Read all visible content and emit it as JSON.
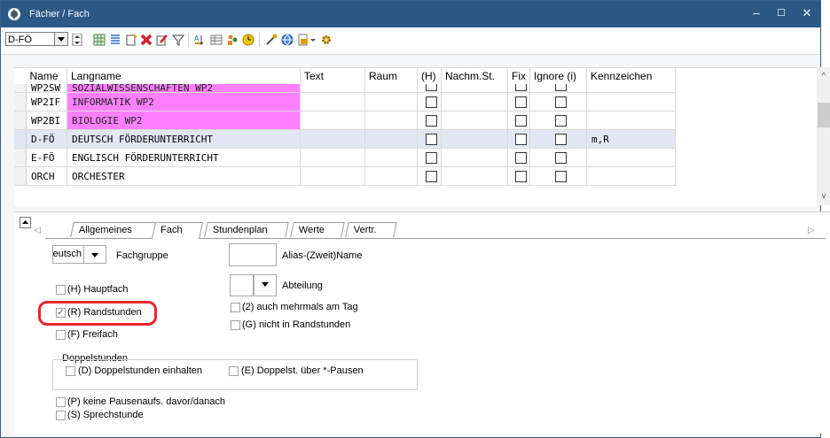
{
  "window": {
    "title": "Fächer / Fach",
    "minimize": "–",
    "maximize": "☐",
    "close": "✕"
  },
  "toolbar": {
    "combo_value": "D-FÖ"
  },
  "grid": {
    "columns": [
      "Name",
      "Langname",
      "Text",
      "Raum",
      "(H)",
      "Nachm.St.",
      "Fix",
      "Ignore (i)",
      "Kennzeichen"
    ],
    "rows": [
      {
        "name": "WP2SW",
        "langname": "SOZIALWISSENSCHAFTEN WP2",
        "text": "",
        "raum": "",
        "nachm": "",
        "kennzeichen": "",
        "pink": true,
        "selected": false
      },
      {
        "name": "WP2IF",
        "langname": "INFORMATIK WP2",
        "text": "",
        "raum": "",
        "nachm": "",
        "kennzeichen": "",
        "pink": true,
        "selected": false
      },
      {
        "name": "WP2BI",
        "langname": "BIOLOGIE WP2",
        "text": "",
        "raum": "",
        "nachm": "",
        "kennzeichen": "",
        "pink": true,
        "selected": false
      },
      {
        "name": "D-FÖ",
        "langname": "DEUTSCH FÖRDERUNTERRICHT",
        "text": "",
        "raum": "",
        "nachm": "",
        "kennzeichen": "m,R",
        "pink": false,
        "selected": true
      },
      {
        "name": "E-FÖ",
        "langname": "ENGLISCH FÖRDERUNTERRICHT",
        "text": "",
        "raum": "",
        "nachm": "",
        "kennzeichen": "",
        "pink": false,
        "selected": false
      },
      {
        "name": "ORCH",
        "langname": "ORCHESTER",
        "text": "",
        "raum": "",
        "nachm": "",
        "kennzeichen": "",
        "pink": false,
        "selected": false
      }
    ]
  },
  "tabs": [
    {
      "label": "Allgemeines",
      "active": false
    },
    {
      "label": "Fach",
      "active": true
    },
    {
      "label": "Stundenplan",
      "active": false
    },
    {
      "label": "Werte",
      "active": false
    },
    {
      "label": "Vertr.",
      "active": false
    }
  ],
  "form": {
    "fachgruppe_value": "Deutsch",
    "fachgruppe_label": "Fachgruppe",
    "alias_label": "Alias-(Zweit)Name",
    "abteilung_label": "Abteilung",
    "hauptfach": {
      "label": "(H) Hauptfach",
      "checked": false
    },
    "randstunden": {
      "label": "(R) Randstunden",
      "checked": true
    },
    "freifach": {
      "label": "(F) Freifach",
      "checked": false
    },
    "mehrmals": {
      "label": "(2) auch mehrmals am Tag",
      "checked": false
    },
    "nicht_rand": {
      "label": "(G) nicht in Randstunden",
      "checked": false
    },
    "doppel_title": "Doppelstunden",
    "doppel_einhalten": {
      "label": "(D) Doppelstunden einhalten",
      "checked": false
    },
    "doppel_pausen": {
      "label": "(E) Doppelst. über *-Pausen",
      "checked": false
    },
    "keine_pausen": {
      "label": "(P) keine Pausenaufs. davor/danach",
      "checked": false
    },
    "sprechstunde": {
      "label": "(S) Sprechstunde",
      "checked": false
    }
  },
  "colors": {
    "title_bg": "#2b5885",
    "pink": "#ff80ff",
    "selected_row": "#e2e8f3",
    "annotation": "#e8262d"
  }
}
